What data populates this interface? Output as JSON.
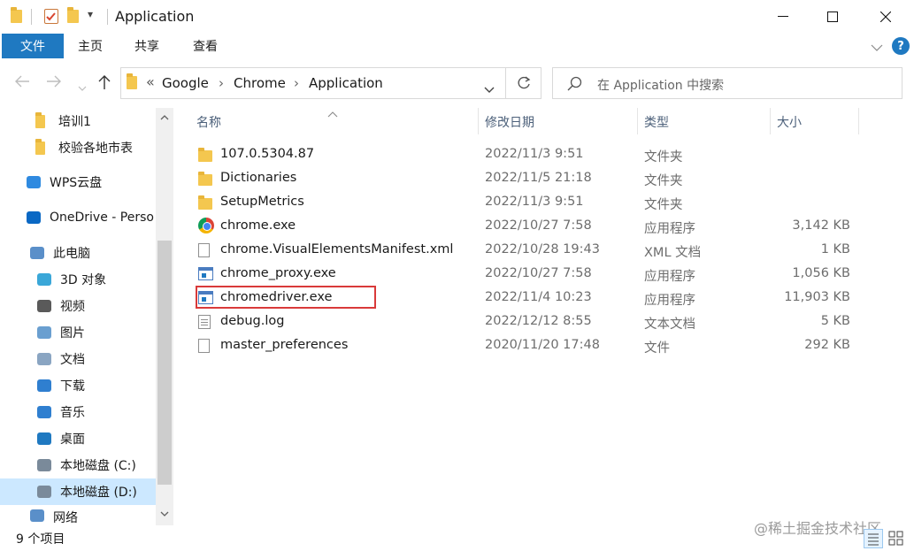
{
  "window": {
    "title": "Application",
    "qa_dropdown": "▾"
  },
  "ribbon": {
    "tabs": [
      "文件",
      "主页",
      "共享",
      "查看"
    ],
    "help": "?"
  },
  "address": {
    "overflow": "«",
    "breadcrumb": [
      "Google",
      "Chrome",
      "Application"
    ],
    "separator": "›"
  },
  "search": {
    "placeholder": "在 Application 中搜索"
  },
  "sidebar": {
    "items": [
      {
        "label": "培训1",
        "icon": "folder-icon"
      },
      {
        "label": "校验各地市表",
        "icon": "folder-icon"
      },
      {
        "label": "WPS云盘",
        "icon": "cloud-icon"
      },
      {
        "label": "OneDrive - Perso",
        "icon": "onedrive-icon"
      },
      {
        "label": "此电脑",
        "icon": "computer-icon"
      },
      {
        "label": "3D 对象",
        "icon": "3d-objects-icon"
      },
      {
        "label": "视频",
        "icon": "video-icon"
      },
      {
        "label": "图片",
        "icon": "pictures-icon"
      },
      {
        "label": "文档",
        "icon": "documents-icon"
      },
      {
        "label": "下载",
        "icon": "download-icon"
      },
      {
        "label": "音乐",
        "icon": "music-icon"
      },
      {
        "label": "桌面",
        "icon": "desktop-icon"
      },
      {
        "label": "本地磁盘 (C:)",
        "icon": "drive-c-icon"
      },
      {
        "label": "本地磁盘 (D:)",
        "icon": "drive-d-icon"
      },
      {
        "label": "网络",
        "icon": "network-icon"
      }
    ]
  },
  "columns": {
    "name": "名称",
    "date": "修改日期",
    "type": "类型",
    "size": "大小"
  },
  "files": [
    {
      "name": "107.0.5304.87",
      "date": "2022/11/3 9:51",
      "type": "文件夹",
      "size": "",
      "icon": "folder-icon"
    },
    {
      "name": "Dictionaries",
      "date": "2022/11/5 21:18",
      "type": "文件夹",
      "size": "",
      "icon": "folder-icon"
    },
    {
      "name": "SetupMetrics",
      "date": "2022/11/3 9:51",
      "type": "文件夹",
      "size": "",
      "icon": "folder-icon"
    },
    {
      "name": "chrome.exe",
      "date": "2022/10/27 7:58",
      "type": "应用程序",
      "size": "3,142 KB",
      "icon": "chrome-icon"
    },
    {
      "name": "chrome.VisualElementsManifest.xml",
      "date": "2022/10/28 19:43",
      "type": "XML 文档",
      "size": "1 KB",
      "icon": "document-icon"
    },
    {
      "name": "chrome_proxy.exe",
      "date": "2022/10/27 7:58",
      "type": "应用程序",
      "size": "1,056 KB",
      "icon": "exe-icon"
    },
    {
      "name": "chromedriver.exe",
      "date": "2022/11/4 10:23",
      "type": "应用程序",
      "size": "11,903 KB",
      "icon": "exe-icon"
    },
    {
      "name": "debug.log",
      "date": "2022/12/12 8:55",
      "type": "文本文档",
      "size": "5 KB",
      "icon": "log-icon"
    },
    {
      "name": "master_preferences",
      "date": "2020/11/20 17:48",
      "type": "文件",
      "size": "292 KB",
      "icon": "document-icon"
    }
  ],
  "status": {
    "count": "9 个项目"
  },
  "watermark": "@稀土掘金技术社区",
  "colors": {
    "accent": "#1f79c1",
    "selection": "#cce8ff",
    "highlight_box": "#d93a3a",
    "folder": "#f4c74f"
  }
}
